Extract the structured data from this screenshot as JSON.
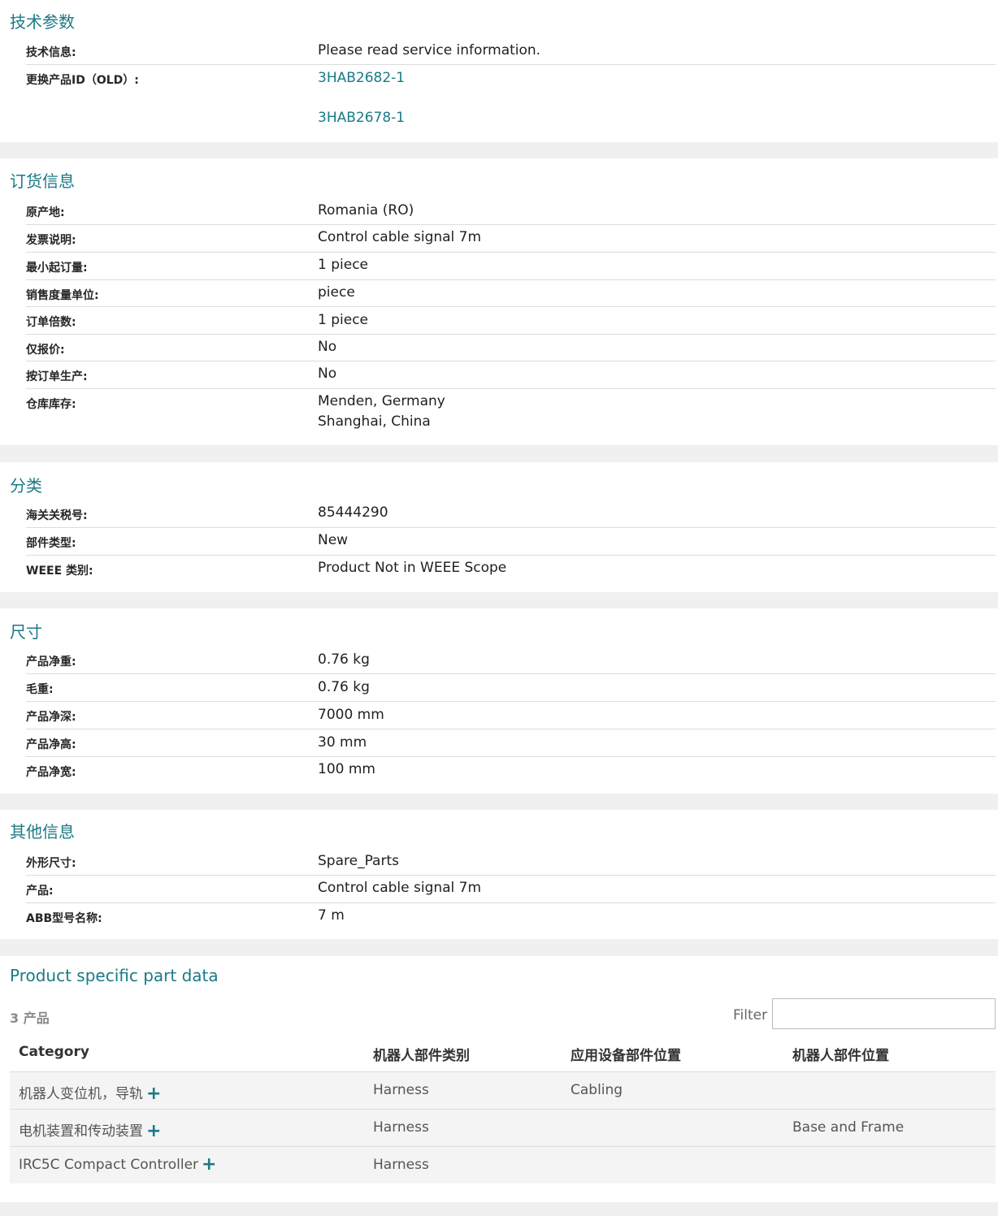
{
  "tech": {
    "title": "技术参数",
    "rows": [
      {
        "label": "技术信息:",
        "value": "Please read service information."
      },
      {
        "label": "更换产品ID（OLD）:",
        "links": [
          "3HAB2682-1",
          "3HAB2678-1"
        ]
      }
    ]
  },
  "ordering": {
    "title": "订货信息",
    "rows": [
      {
        "label": "原产地:",
        "value": "Romania (RO)"
      },
      {
        "label": "发票说明:",
        "value": "Control cable signal 7m"
      },
      {
        "label": "最小起订量:",
        "value": "1 piece"
      },
      {
        "label": "销售度量单位:",
        "value": "piece"
      },
      {
        "label": "订单倍数:",
        "value": "1 piece"
      },
      {
        "label": "仅报价:",
        "value": "No"
      },
      {
        "label": "按订单生产:",
        "value": "No"
      },
      {
        "label": "仓库库存:",
        "value_lines": [
          "Menden, Germany",
          "Shanghai, China"
        ]
      }
    ]
  },
  "classification": {
    "title": "分类",
    "rows": [
      {
        "label": "海关关税号:",
        "value": "85444290"
      },
      {
        "label": "部件类型:",
        "value": "New"
      },
      {
        "label": "WEEE 类别:",
        "value": "Product Not in WEEE Scope"
      }
    ]
  },
  "dimensions": {
    "title": "尺寸",
    "rows": [
      {
        "label": "产品净重:",
        "value": "0.76 kg"
      },
      {
        "label": "毛重:",
        "value": "0.76 kg"
      },
      {
        "label": "产品净深:",
        "value": "7000 mm"
      },
      {
        "label": "产品净高:",
        "value": "30 mm"
      },
      {
        "label": "产品净宽:",
        "value": "100 mm"
      }
    ]
  },
  "other": {
    "title": "其他信息",
    "rows": [
      {
        "label": "外形尺寸:",
        "value": "Spare_Parts"
      },
      {
        "label": "产品:",
        "value": "Control cable signal 7m"
      },
      {
        "label": "ABB型号名称:",
        "value": "7 m"
      }
    ]
  },
  "psp": {
    "title": "Product specific part data",
    "count": "3 产品",
    "filter_label": "Filter",
    "filter_value": "",
    "headers": [
      "Category",
      "机器人部件类别",
      "应用设备部件位置",
      "机器人部件位置"
    ],
    "rows": [
      [
        "机器人变位机，导轨",
        "Harness",
        "Cabling",
        ""
      ],
      [
        "电机装置和传动装置",
        "Harness",
        "",
        "Base and Frame"
      ],
      [
        "IRC5C Compact Controller",
        "Harness",
        "",
        ""
      ]
    ],
    "expand_icon": "plus-icon"
  }
}
